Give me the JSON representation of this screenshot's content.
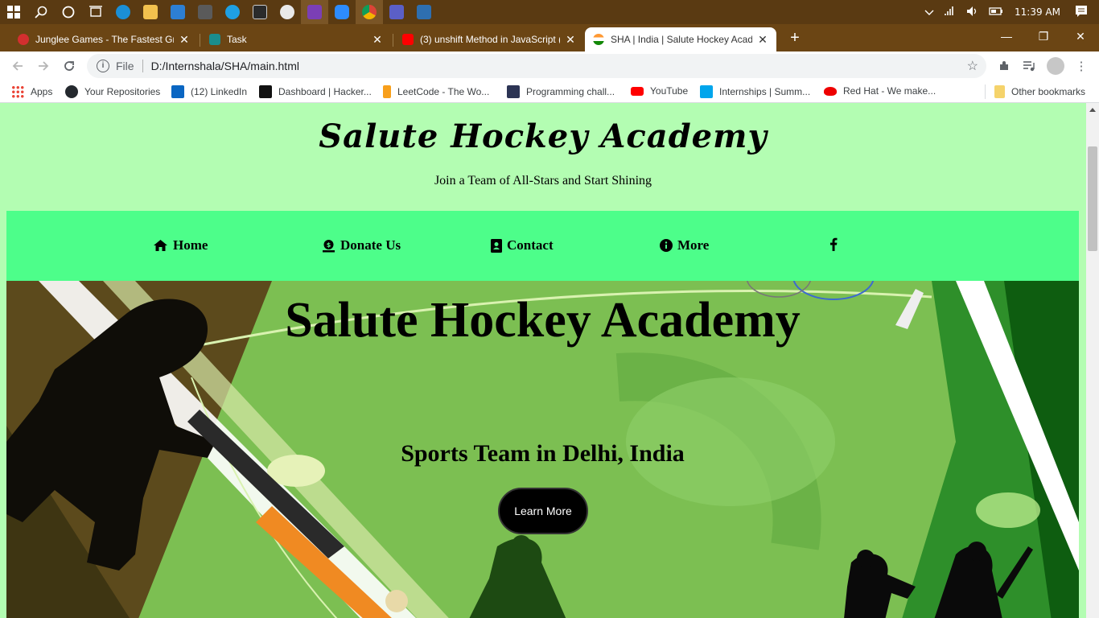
{
  "taskbar": {
    "time": "11:39 AM",
    "apps": [
      {
        "name": "edge",
        "color": "#1b8fd6"
      },
      {
        "name": "file-explorer",
        "color": "#f2c14e"
      },
      {
        "name": "mail",
        "color": "#2d7fd3"
      },
      {
        "name": "store",
        "color": "#5a5a5a"
      },
      {
        "name": "skype",
        "color": "#1fa0e3"
      },
      {
        "name": "terminal",
        "color": "#2b2b2b"
      },
      {
        "name": "slack",
        "color": "#e9e9e9"
      },
      {
        "name": "onenote",
        "color": "#7b3fb5"
      },
      {
        "name": "zoom",
        "color": "#2d8cff"
      },
      {
        "name": "chrome",
        "color": "#e8b923"
      },
      {
        "name": "teams",
        "color": "#5b5fc7"
      },
      {
        "name": "photos",
        "color": "#2e6fb0"
      }
    ]
  },
  "tabs": [
    {
      "title": "Junglee Games - The Fastest Gro",
      "favicon_color": "#d32f2f"
    },
    {
      "title": "Task",
      "favicon_color": "#1a8d8d"
    },
    {
      "title": "(3) unshift Method in JavaScript (",
      "favicon_color": "#ff0000"
    },
    {
      "title": "SHA | India | Salute Hockey Acad",
      "favicon_color": "#ff9933"
    }
  ],
  "address": {
    "scheme_label": "File",
    "url": "D:/Internshala/SHA/main.html"
  },
  "bookmarks": [
    {
      "label": "Apps",
      "icon_color": "#4285f4"
    },
    {
      "label": "Your Repositories",
      "icon_color": "#24292e"
    },
    {
      "label": "(12) LinkedIn",
      "icon_color": "#0a66c2"
    },
    {
      "label": "Dashboard | Hacker...",
      "icon_color": "#111111"
    },
    {
      "label": "LeetCode - The Wo...",
      "icon_color": "#f89f1b"
    },
    {
      "label": "Programming chall...",
      "icon_color": "#2c3454"
    },
    {
      "label": "YouTube",
      "icon_color": "#ff0000"
    },
    {
      "label": "Internships | Summ...",
      "icon_color": "#00a5ec"
    },
    {
      "label": "Red Hat - We make...",
      "icon_color": "#ee0000"
    }
  ],
  "other_bookmarks": "Other bookmarks",
  "page": {
    "brand": "Salute Hockey Academy",
    "tagline": "Join a Team of All-Stars and Start Shining",
    "nav": [
      {
        "label": "Home",
        "icon": "home-icon"
      },
      {
        "label": "Donate Us",
        "icon": "donate-icon"
      },
      {
        "label": "Contact",
        "icon": "contact-icon"
      },
      {
        "label": "More",
        "icon": "info-icon"
      },
      {
        "label": "",
        "icon": "facebook-icon"
      }
    ],
    "hero_title": "Salute Hockey Academy",
    "hero_subtitle": "Sports Team in Delhi, India",
    "cta_label": "Learn More",
    "colors": {
      "header_bg": "#b3fdb2",
      "nav_bg": "#4dfe8a",
      "button_bg": "#000000"
    }
  }
}
